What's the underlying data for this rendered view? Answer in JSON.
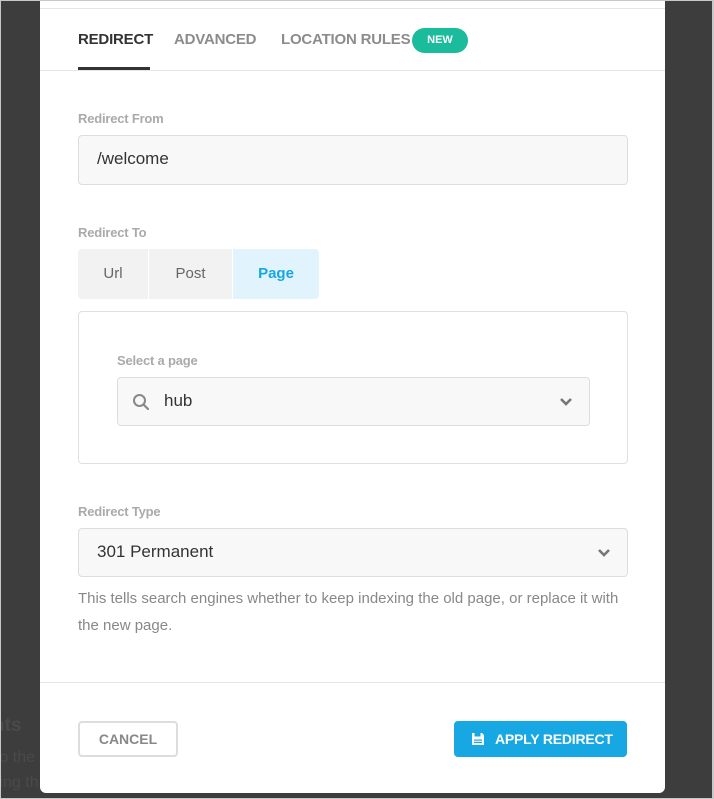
{
  "background": {
    "title_fragment": "nts",
    "line1_fragment": "to the",
    "line2_fragment": "ting th"
  },
  "tabs": [
    {
      "label": "REDIRECT",
      "active": true
    },
    {
      "label": "ADVANCED",
      "active": false
    },
    {
      "label": "LOCATION RULES",
      "active": false,
      "badge": "NEW"
    }
  ],
  "redirect_from": {
    "label": "Redirect From",
    "value": "/welcome"
  },
  "redirect_to": {
    "label": "Redirect To",
    "options": [
      "Url",
      "Post",
      "Page"
    ],
    "selected": "Page"
  },
  "page_select": {
    "label": "Select a page",
    "value": "hub",
    "icon": "search-icon"
  },
  "redirect_type": {
    "label": "Redirect Type",
    "value": "301 Permanent",
    "help": "This tells search engines whether to keep indexing the old page, or replace it with the new page."
  },
  "footer": {
    "cancel_label": "CANCEL",
    "apply_label": "APPLY REDIRECT",
    "apply_icon": "save-icon"
  },
  "colors": {
    "accent": "#17a8e3",
    "badge": "#1abc9c",
    "overlay": "#3d3d3d"
  }
}
